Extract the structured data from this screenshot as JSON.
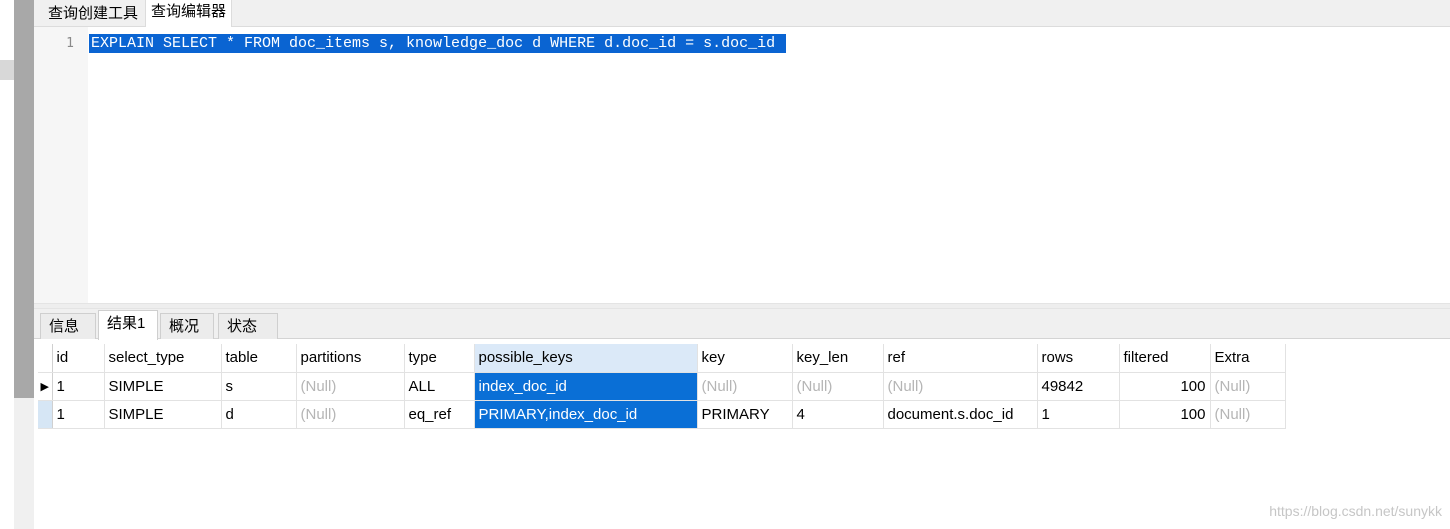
{
  "top_tabs": [
    "查询创建工具",
    "查询编辑器"
  ],
  "editor": {
    "line_number": "1",
    "code": "EXPLAIN SELECT * FROM doc_items s, knowledge_doc d WHERE d.doc_id = s.doc_id "
  },
  "result_tabs": [
    "信息",
    "结果1",
    "概况",
    "状态"
  ],
  "grid": {
    "columns": [
      "id",
      "select_type",
      "table",
      "partitions",
      "type",
      "possible_keys",
      "key",
      "key_len",
      "ref",
      "rows",
      "filtered",
      "Extra"
    ],
    "rows": [
      [
        "1",
        "SIMPLE",
        "s",
        "(Null)",
        "ALL",
        "index_doc_id",
        "(Null)",
        "(Null)",
        "(Null)",
        "49842",
        "100",
        "(Null)"
      ],
      [
        "1",
        "SIMPLE",
        "d",
        "(Null)",
        "eq_ref",
        "PRIMARY,index_doc_id",
        "PRIMARY",
        "4",
        "document.s.doc_id",
        "1",
        "100",
        "(Null)"
      ]
    ],
    "current_row_marker": "▶"
  },
  "watermark": "https://blog.csdn.net/sunykk",
  "colors": {
    "selection": "#0a6fd6",
    "header_highlight": "#dbe9f8",
    "null_text": "#b5b5b5"
  }
}
